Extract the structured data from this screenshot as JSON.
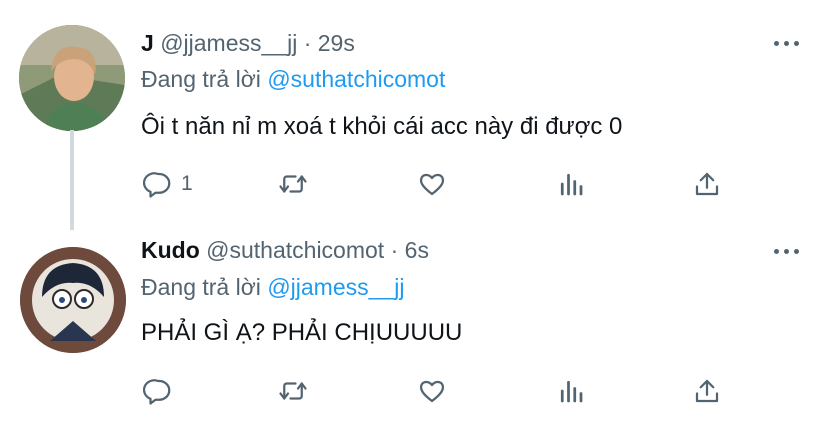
{
  "tweets": [
    {
      "display_name": "J",
      "handle": "@jjamess__jj",
      "time": "29s",
      "reply_prefix": "Đang trả lời",
      "reply_to": "@suthatchicomot",
      "text": "Ôi t năn nỉ m xoá t khỏi cái acc này đi được 0",
      "reply_count": "1"
    },
    {
      "display_name": "Kudo",
      "handle": "@suthatchicomot",
      "time": "6s",
      "reply_prefix": "Đang trả lời",
      "reply_to": "@jjamess__jj",
      "text": "PHẢI GÌ Ạ? PHẢI CHỊUUUUU",
      "reply_count": ""
    }
  ],
  "separator": "·",
  "icons": [
    "reply-icon",
    "retweet-icon",
    "like-icon",
    "analytics-icon",
    "share-icon",
    "more-icon"
  ],
  "colors": {
    "accent": "#1d9bf0",
    "muted": "#536471",
    "text": "#0f1419"
  }
}
